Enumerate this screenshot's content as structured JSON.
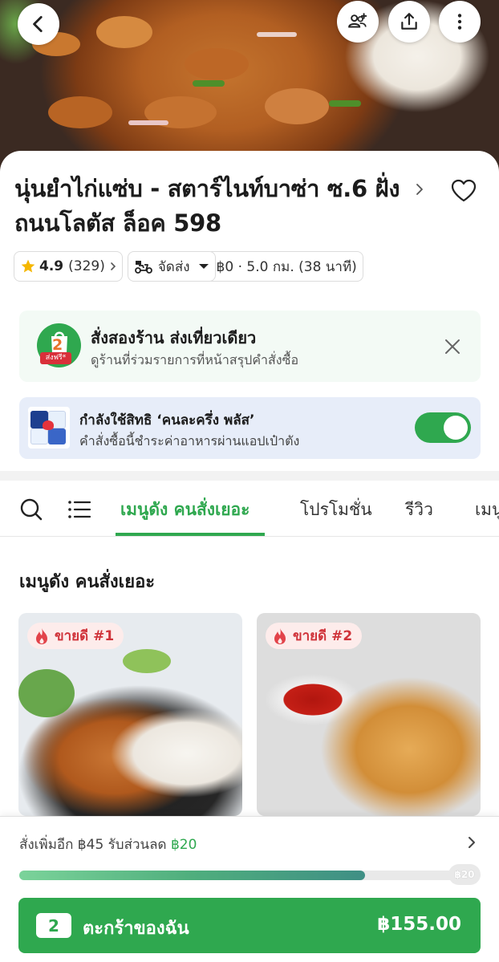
{
  "store": {
    "title": "นุ่นยำไก่แซ่บ - สตาร์ไนท์บาซ่า ซ.6 ฝั่งถนนโลตัส ล็อค 598",
    "rating": "4.9",
    "rating_count": "(329)",
    "delivery_mode": "จัดส่ง",
    "delivery_info": "฿0 · 5.0 กม. (38 นาที)"
  },
  "banners": {
    "multi_store": {
      "title": "สั่งสองร้าน ส่งเที่ยวเดียว",
      "subtitle": "ดูร้านที่ร่วมรายการที่หน้าสรุปคำสั่งซื้อ",
      "badge_number": "2",
      "badge_text": "ส่งฟรี*"
    },
    "privilege": {
      "title": "กำลังใช้สิทธิ ‘คนละครึ่ง พลัส’",
      "subtitle": "คำสั่งซื้อนี้ชำระค่าอาหารผ่านแอปเป๋าตัง",
      "toggle_on": true
    }
  },
  "tabs": [
    "เมนูดัง คนสั่งเยอะ",
    "โปรโมชั่น",
    "รีวิว",
    "เมนู"
  ],
  "section_title": "เมนูดัง คนสั่งเยอะ",
  "items": [
    {
      "badge": "ขายดี #1"
    },
    {
      "badge": "ขายดี #2"
    }
  ],
  "bottom": {
    "promo_prefix": "สั่งเพิ่มอีก ฿45 รับส่วนลด ",
    "promo_amount": "฿20",
    "progress_fraction": 0.75,
    "progress_end_label": "฿20",
    "cart_count": "2",
    "cart_label": "ตะกร้าของฉัน",
    "cart_total": "฿155.00"
  },
  "colors": {
    "brand_green": "#2fa84f",
    "badge_red": "#d0333a",
    "privilege_bg": "#e7edf9"
  },
  "icons": [
    "back-icon",
    "add-friend-icon",
    "share-icon",
    "more-icon",
    "heart-icon",
    "star-icon",
    "scooter-icon",
    "search-icon",
    "menu-list-icon",
    "close-icon",
    "fire-icon"
  ]
}
